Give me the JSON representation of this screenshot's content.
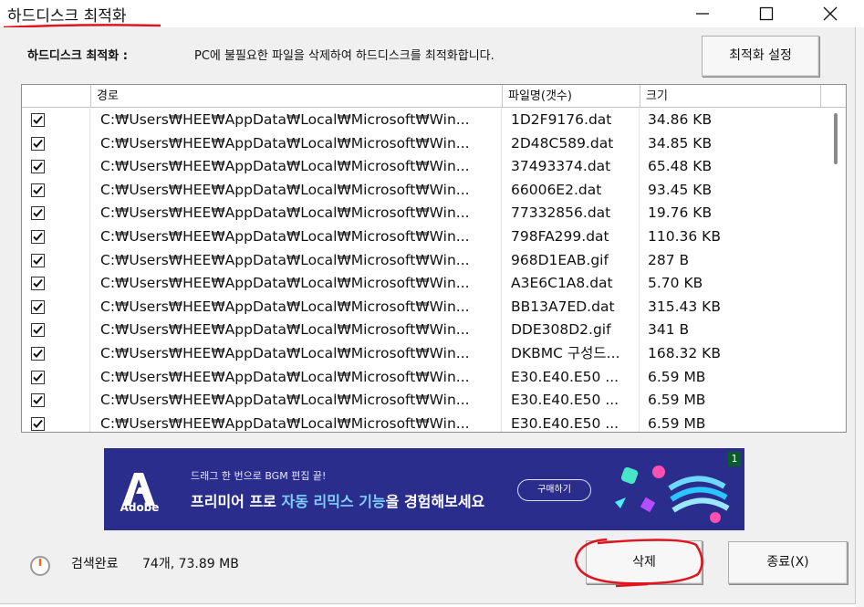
{
  "window": {
    "title": "하드디스크 최적화"
  },
  "header": {
    "label": "하드디스크 최적화 :",
    "description": "PC에 불필요한 파일을 삭제하여 하드디스크를 최적화합니다.",
    "settings_button": "최적화 설정"
  },
  "columns": {
    "path": "경로",
    "name": "파일명(갯수)",
    "size": "크기"
  },
  "rows": [
    {
      "checked": true,
      "path": "C:₩Users₩HEE₩AppData₩Local₩Microsoft₩Win...",
      "name": "1D2F9176.dat",
      "size": "34.86 KB"
    },
    {
      "checked": true,
      "path": "C:₩Users₩HEE₩AppData₩Local₩Microsoft₩Win...",
      "name": "2D48C589.dat",
      "size": "34.85 KB"
    },
    {
      "checked": true,
      "path": "C:₩Users₩HEE₩AppData₩Local₩Microsoft₩Win...",
      "name": "37493374.dat",
      "size": "65.48 KB"
    },
    {
      "checked": true,
      "path": "C:₩Users₩HEE₩AppData₩Local₩Microsoft₩Win...",
      "name": "66006E2.dat",
      "size": "93.45 KB"
    },
    {
      "checked": true,
      "path": "C:₩Users₩HEE₩AppData₩Local₩Microsoft₩Win...",
      "name": "77332856.dat",
      "size": "19.76 KB"
    },
    {
      "checked": true,
      "path": "C:₩Users₩HEE₩AppData₩Local₩Microsoft₩Win...",
      "name": "798FA299.dat",
      "size": "110.36 KB"
    },
    {
      "checked": true,
      "path": "C:₩Users₩HEE₩AppData₩Local₩Microsoft₩Win...",
      "name": "968D1EAB.gif",
      "size": "287 B"
    },
    {
      "checked": true,
      "path": "C:₩Users₩HEE₩AppData₩Local₩Microsoft₩Win...",
      "name": "A3E6C1A8.dat",
      "size": "5.70 KB"
    },
    {
      "checked": true,
      "path": "C:₩Users₩HEE₩AppData₩Local₩Microsoft₩Win...",
      "name": "BB13A7ED.dat",
      "size": "315.43 KB"
    },
    {
      "checked": true,
      "path": "C:₩Users₩HEE₩AppData₩Local₩Microsoft₩Win...",
      "name": "DDE308D2.gif",
      "size": "341 B"
    },
    {
      "checked": true,
      "path": "C:₩Users₩HEE₩AppData₩Local₩Microsoft₩Win...",
      "name": "DKBMC 구성드...",
      "size": "168.32 KB"
    },
    {
      "checked": true,
      "path": "C:₩Users₩HEE₩AppData₩Local₩Microsoft₩Win...",
      "name": "E30.E40.E50 ...",
      "size": "6.59 MB"
    },
    {
      "checked": true,
      "path": "C:₩Users₩HEE₩AppData₩Local₩Microsoft₩Win...",
      "name": "E30.E40.E50 ...",
      "size": "6.59 MB"
    },
    {
      "checked": true,
      "path": "C:₩Users₩HEE₩AppData₩Local₩Microsoft₩Win...",
      "name": "E30.E40.E50 ...",
      "size": "6.59 MB"
    }
  ],
  "ad": {
    "brand": "Adobe",
    "line1": "드래그 한 번으로 BGM 편집 끝!",
    "line2_pre": "프리미어 프로 ",
    "line2_highlight": "자동 리믹스 기능",
    "line2_post": "을 경험해보세요",
    "cta": "구매하기",
    "badge": "1"
  },
  "status": {
    "label": "검색완료",
    "count": "74개, 73.89 MB"
  },
  "buttons": {
    "delete": "삭제",
    "close": "종료(X)"
  },
  "colors": {
    "ad_background": "#2a2d8c",
    "annotation": "#e0141e",
    "highlight": "#7fd0ff"
  }
}
